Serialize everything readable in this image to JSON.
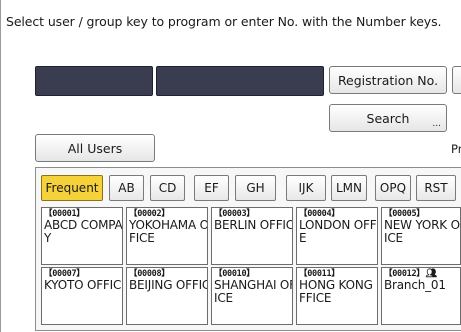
{
  "instruction": "Select user / group key to program or enter No. with the Number keys.",
  "buttons": {
    "registration_no": "Registration No.",
    "search": "Search",
    "search_suffix": "...",
    "all_users": "All Users",
    "partial_label": "Pr"
  },
  "tabs": [
    "Frequent",
    "AB",
    "CD",
    "EF",
    "GH",
    "IJK",
    "LMN",
    "OPQ",
    "RST"
  ],
  "active_tab": "Frequent",
  "entries": [
    {
      "number": "【00001】",
      "name": "ABCD COMPANY"
    },
    {
      "number": "【00002】",
      "name": "YOKOHAMA OFFICE"
    },
    {
      "number": "【00003】",
      "name": "BERLIN OFFICE"
    },
    {
      "number": "【00004】",
      "name": "LONDON OFFICE"
    },
    {
      "number": "【00005】",
      "name": "NEW YORK OFFICE"
    },
    {
      "number": "【00007】",
      "name": "KYOTO OFFICE"
    },
    {
      "number": "【00008】",
      "name": "BEIJING OFFICE"
    },
    {
      "number": "【00010】",
      "name": "SHANGHAI OFFICE"
    },
    {
      "number": "【00011】",
      "name": "HONG KONG OFFICE"
    },
    {
      "number": "【00012】",
      "name": "Branch_01",
      "group_icon": "group-users-icon"
    }
  ],
  "colors": {
    "active_tab": "#f5d23a",
    "dark_field": "#3a3d4f"
  }
}
